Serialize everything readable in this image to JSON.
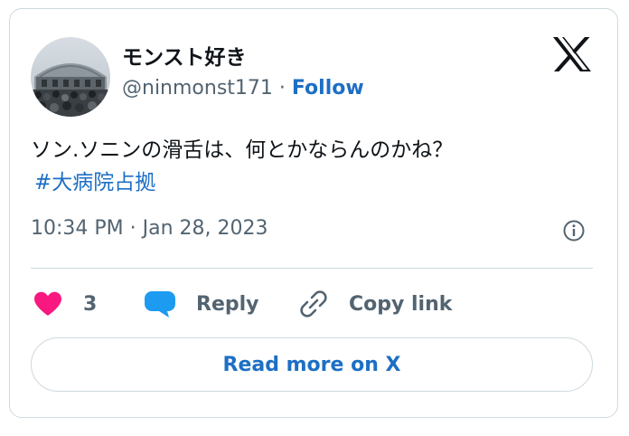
{
  "author": {
    "display_name": "モンスト好き",
    "handle": "@ninmonst171",
    "separator": "·",
    "follow_label": "Follow"
  },
  "tweet": {
    "text": "ソン.ソニンの滑舌は、何とかならんのかね？",
    "hashtag": "#大病院占拠",
    "timestamp": "10:34 PM · Jan 28, 2023"
  },
  "actions": {
    "like_count": "3",
    "reply_label": "Reply",
    "copy_link_label": "Copy link"
  },
  "read_more_label": "Read more on X",
  "icons": {
    "logo": "x-logo-icon",
    "info": "info-icon",
    "like": "heart-icon",
    "reply": "speech-bubble-icon",
    "copy": "link-icon"
  },
  "colors": {
    "link": "#1d6fc4",
    "heart": "#f91880",
    "reply_bubble": "#1d9bf0",
    "text": "#0f1419",
    "secondary_text": "#536471",
    "border": "#cfd9de"
  }
}
